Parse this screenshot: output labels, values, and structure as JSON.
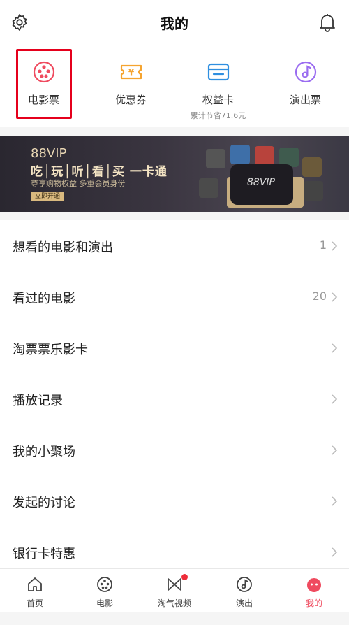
{
  "header": {
    "title": "我的",
    "settings_icon": "gear-icon",
    "notifications_icon": "bell-icon"
  },
  "quick_actions": [
    {
      "label": "电影票",
      "icon": "film-reel-icon",
      "color": "#ef4b5f",
      "sub": ""
    },
    {
      "label": "优惠券",
      "icon": "coupon-ticket-icon",
      "color": "#f5a430",
      "sub": ""
    },
    {
      "label": "权益卡",
      "icon": "card-icon",
      "color": "#2f8fe0",
      "sub": "累计节省71.6元"
    },
    {
      "label": "演出票",
      "icon": "music-disc-icon",
      "color": "#9a6cf0",
      "sub": ""
    }
  ],
  "banner": {
    "brand": "88VIP",
    "headline": "吃│玩│听│看│买 一卡通",
    "description": "尊享购物权益 多重会员身份",
    "cta": "立即开通",
    "card_text": "88VIP"
  },
  "list": [
    {
      "label": "想看的电影和演出",
      "count": "1"
    },
    {
      "label": "看过的电影",
      "count": "20"
    },
    {
      "label": "淘票票乐影卡",
      "count": ""
    },
    {
      "label": "播放记录",
      "count": ""
    },
    {
      "label": "我的小聚场",
      "count": ""
    },
    {
      "label": "发起的讨论",
      "count": ""
    },
    {
      "label": "银行卡特惠",
      "count": ""
    }
  ],
  "tabbar": [
    {
      "label": "首页",
      "icon": "home-icon"
    },
    {
      "label": "电影",
      "icon": "film-reel-icon"
    },
    {
      "label": "淘气视频",
      "icon": "video-icon",
      "badge": true
    },
    {
      "label": "演出",
      "icon": "music-disc-icon"
    },
    {
      "label": "我的",
      "icon": "profile-mascot-icon",
      "active": true
    }
  ],
  "colors": {
    "accent": "#ef4b5f",
    "highlight_box": "#e5001c",
    "banner_gold": "#e9d7b4"
  }
}
